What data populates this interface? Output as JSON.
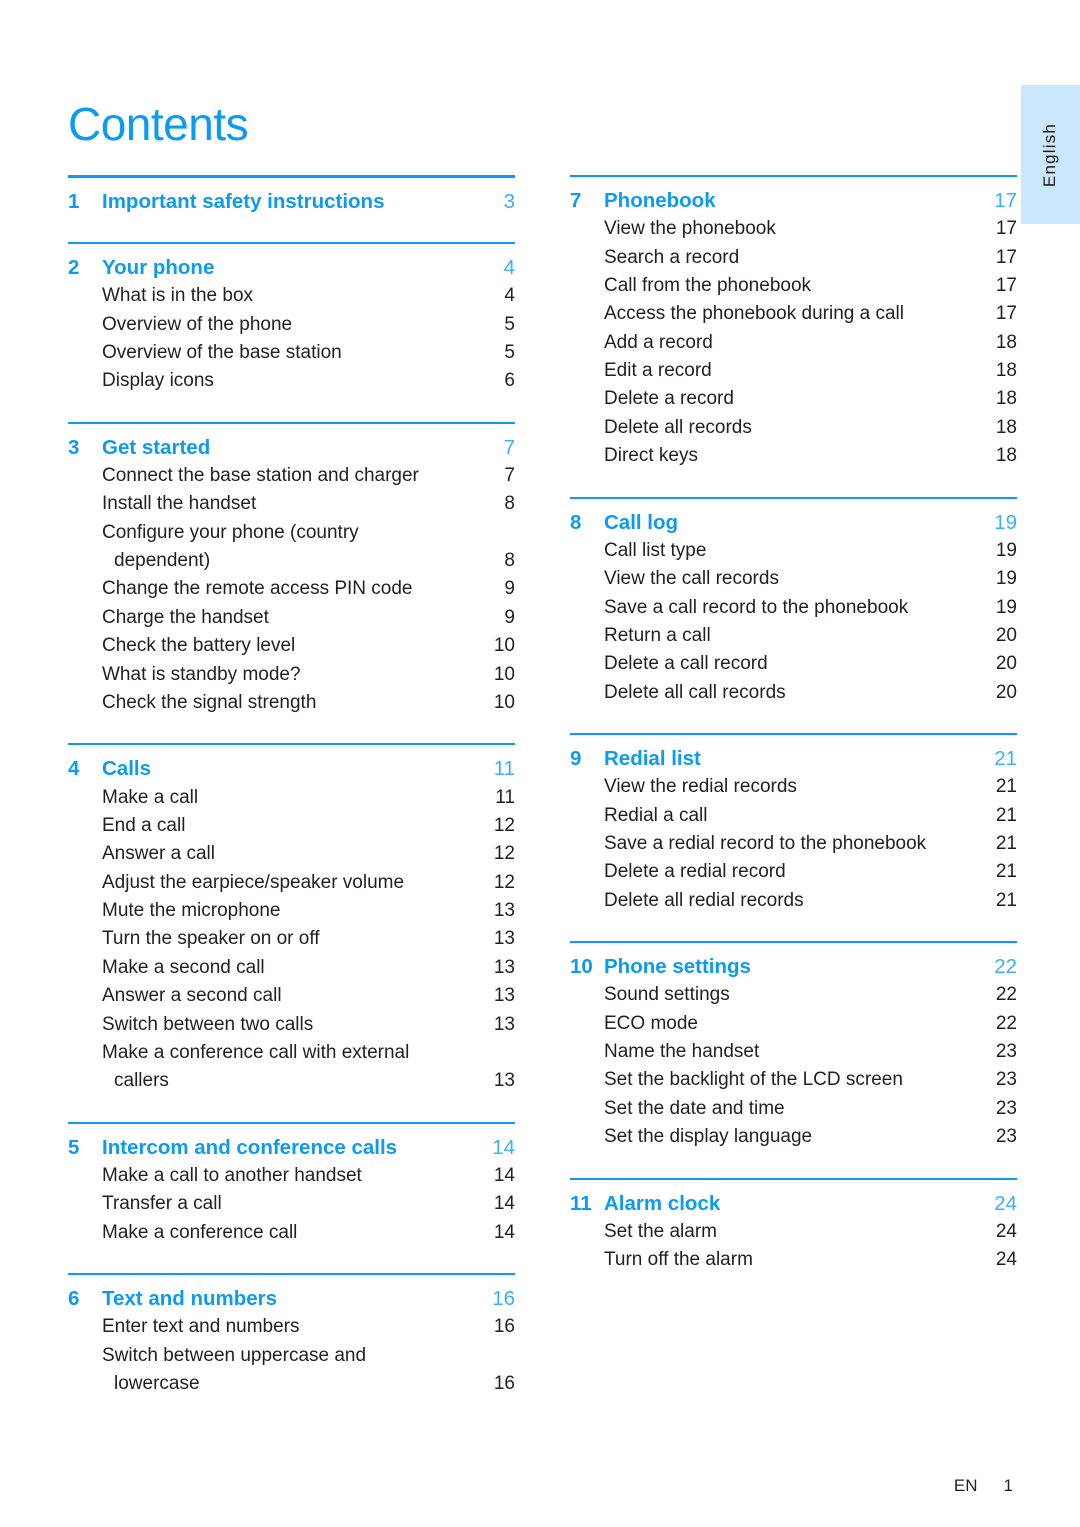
{
  "title": "Contents",
  "side_tab": {
    "label": "English"
  },
  "footer": {
    "lang_code": "EN",
    "page_number": "1"
  },
  "colors": {
    "accent_blue": "#0d9bf2",
    "page_number_blue": "#3cb0f7",
    "body_text": "#231f20",
    "tab_background": "#cbe7fb"
  },
  "columns": [
    {
      "name": "left",
      "sections": [
        {
          "number": "1",
          "title": "Important safety instructions",
          "page": "3",
          "entries": []
        },
        {
          "number": "2",
          "title": "Your phone",
          "page": "4",
          "entries": [
            {
              "lines": [
                "What is in the box"
              ],
              "page": "4"
            },
            {
              "lines": [
                "Overview of the phone"
              ],
              "page": "5"
            },
            {
              "lines": [
                "Overview of the base station"
              ],
              "page": "5"
            },
            {
              "lines": [
                "Display icons"
              ],
              "page": "6"
            }
          ]
        },
        {
          "number": "3",
          "title": "Get started",
          "page": "7",
          "entries": [
            {
              "lines": [
                "Connect the base station and charger"
              ],
              "page": "7"
            },
            {
              "lines": [
                "Install the handset"
              ],
              "page": "8"
            },
            {
              "lines": [
                "Configure your phone (country",
                "dependent)"
              ],
              "page": "8"
            },
            {
              "lines": [
                "Change the remote access PIN code"
              ],
              "page": "9"
            },
            {
              "lines": [
                "Charge the handset"
              ],
              "page": "9"
            },
            {
              "lines": [
                "Check the battery level"
              ],
              "page": "10"
            },
            {
              "lines": [
                "What is standby mode?"
              ],
              "page": "10"
            },
            {
              "lines": [
                "Check the signal strength"
              ],
              "page": "10"
            }
          ]
        },
        {
          "number": "4",
          "title": "Calls",
          "page": "11",
          "entries": [
            {
              "lines": [
                "Make a call"
              ],
              "page": "11"
            },
            {
              "lines": [
                "End a call"
              ],
              "page": "12"
            },
            {
              "lines": [
                "Answer a call"
              ],
              "page": "12"
            },
            {
              "lines": [
                "Adjust the earpiece/speaker volume"
              ],
              "page": "12"
            },
            {
              "lines": [
                "Mute the microphone"
              ],
              "page": "13"
            },
            {
              "lines": [
                "Turn the speaker on or off"
              ],
              "page": "13"
            },
            {
              "lines": [
                "Make a second call"
              ],
              "page": "13"
            },
            {
              "lines": [
                "Answer a second call"
              ],
              "page": "13"
            },
            {
              "lines": [
                "Switch between two calls"
              ],
              "page": "13"
            },
            {
              "lines": [
                "Make a conference call with external",
                "callers"
              ],
              "page": "13"
            }
          ]
        },
        {
          "number": "5",
          "title": "Intercom and conference calls",
          "page": "14",
          "entries": [
            {
              "lines": [
                "Make a call to another handset"
              ],
              "page": "14"
            },
            {
              "lines": [
                "Transfer a call"
              ],
              "page": "14"
            },
            {
              "lines": [
                "Make a conference call"
              ],
              "page": "14"
            }
          ]
        },
        {
          "number": "6",
          "title": "Text and numbers",
          "page": "16",
          "entries": [
            {
              "lines": [
                "Enter text and numbers"
              ],
              "page": "16"
            },
            {
              "lines": [
                "Switch between uppercase and",
                "lowercase"
              ],
              "page": "16"
            }
          ]
        }
      ]
    },
    {
      "name": "right",
      "sections": [
        {
          "number": "7",
          "title": "Phonebook",
          "page": "17",
          "entries": [
            {
              "lines": [
                "View the phonebook"
              ],
              "page": "17"
            },
            {
              "lines": [
                "Search a record"
              ],
              "page": "17"
            },
            {
              "lines": [
                "Call from the phonebook"
              ],
              "page": "17"
            },
            {
              "lines": [
                "Access the phonebook during a call"
              ],
              "page": "17"
            },
            {
              "lines": [
                "Add a record"
              ],
              "page": "18"
            },
            {
              "lines": [
                "Edit a record"
              ],
              "page": "18"
            },
            {
              "lines": [
                "Delete a record"
              ],
              "page": "18"
            },
            {
              "lines": [
                "Delete all records"
              ],
              "page": "18"
            },
            {
              "lines": [
                "Direct keys"
              ],
              "page": "18"
            }
          ]
        },
        {
          "number": "8",
          "title": "Call log",
          "page": "19",
          "entries": [
            {
              "lines": [
                "Call list type"
              ],
              "page": "19"
            },
            {
              "lines": [
                "View the call records"
              ],
              "page": "19"
            },
            {
              "lines": [
                "Save a call record to the phonebook"
              ],
              "page": "19"
            },
            {
              "lines": [
                "Return a call"
              ],
              "page": "20"
            },
            {
              "lines": [
                "Delete a call record"
              ],
              "page": "20"
            },
            {
              "lines": [
                "Delete all call records"
              ],
              "page": "20"
            }
          ]
        },
        {
          "number": "9",
          "title": "Redial list",
          "page": "21",
          "entries": [
            {
              "lines": [
                "View the redial records"
              ],
              "page": "21"
            },
            {
              "lines": [
                "Redial a call"
              ],
              "page": "21"
            },
            {
              "lines": [
                "Save a redial record to the phonebook"
              ],
              "page": "21"
            },
            {
              "lines": [
                "Delete a redial record"
              ],
              "page": "21"
            },
            {
              "lines": [
                "Delete all redial records"
              ],
              "page": "21"
            }
          ]
        },
        {
          "number": "10",
          "title": "Phone settings",
          "page": "22",
          "entries": [
            {
              "lines": [
                "Sound settings"
              ],
              "page": "22"
            },
            {
              "lines": [
                "ECO mode"
              ],
              "page": "22"
            },
            {
              "lines": [
                "Name the handset"
              ],
              "page": "23"
            },
            {
              "lines": [
                "Set the backlight of the LCD screen"
              ],
              "page": "23"
            },
            {
              "lines": [
                "Set the date and time"
              ],
              "page": "23"
            },
            {
              "lines": [
                "Set the display language"
              ],
              "page": "23"
            }
          ]
        },
        {
          "number": "11",
          "title": "Alarm clock",
          "page": "24",
          "entries": [
            {
              "lines": [
                "Set the alarm"
              ],
              "page": "24"
            },
            {
              "lines": [
                "Turn off the alarm"
              ],
              "page": "24"
            }
          ]
        }
      ]
    }
  ]
}
